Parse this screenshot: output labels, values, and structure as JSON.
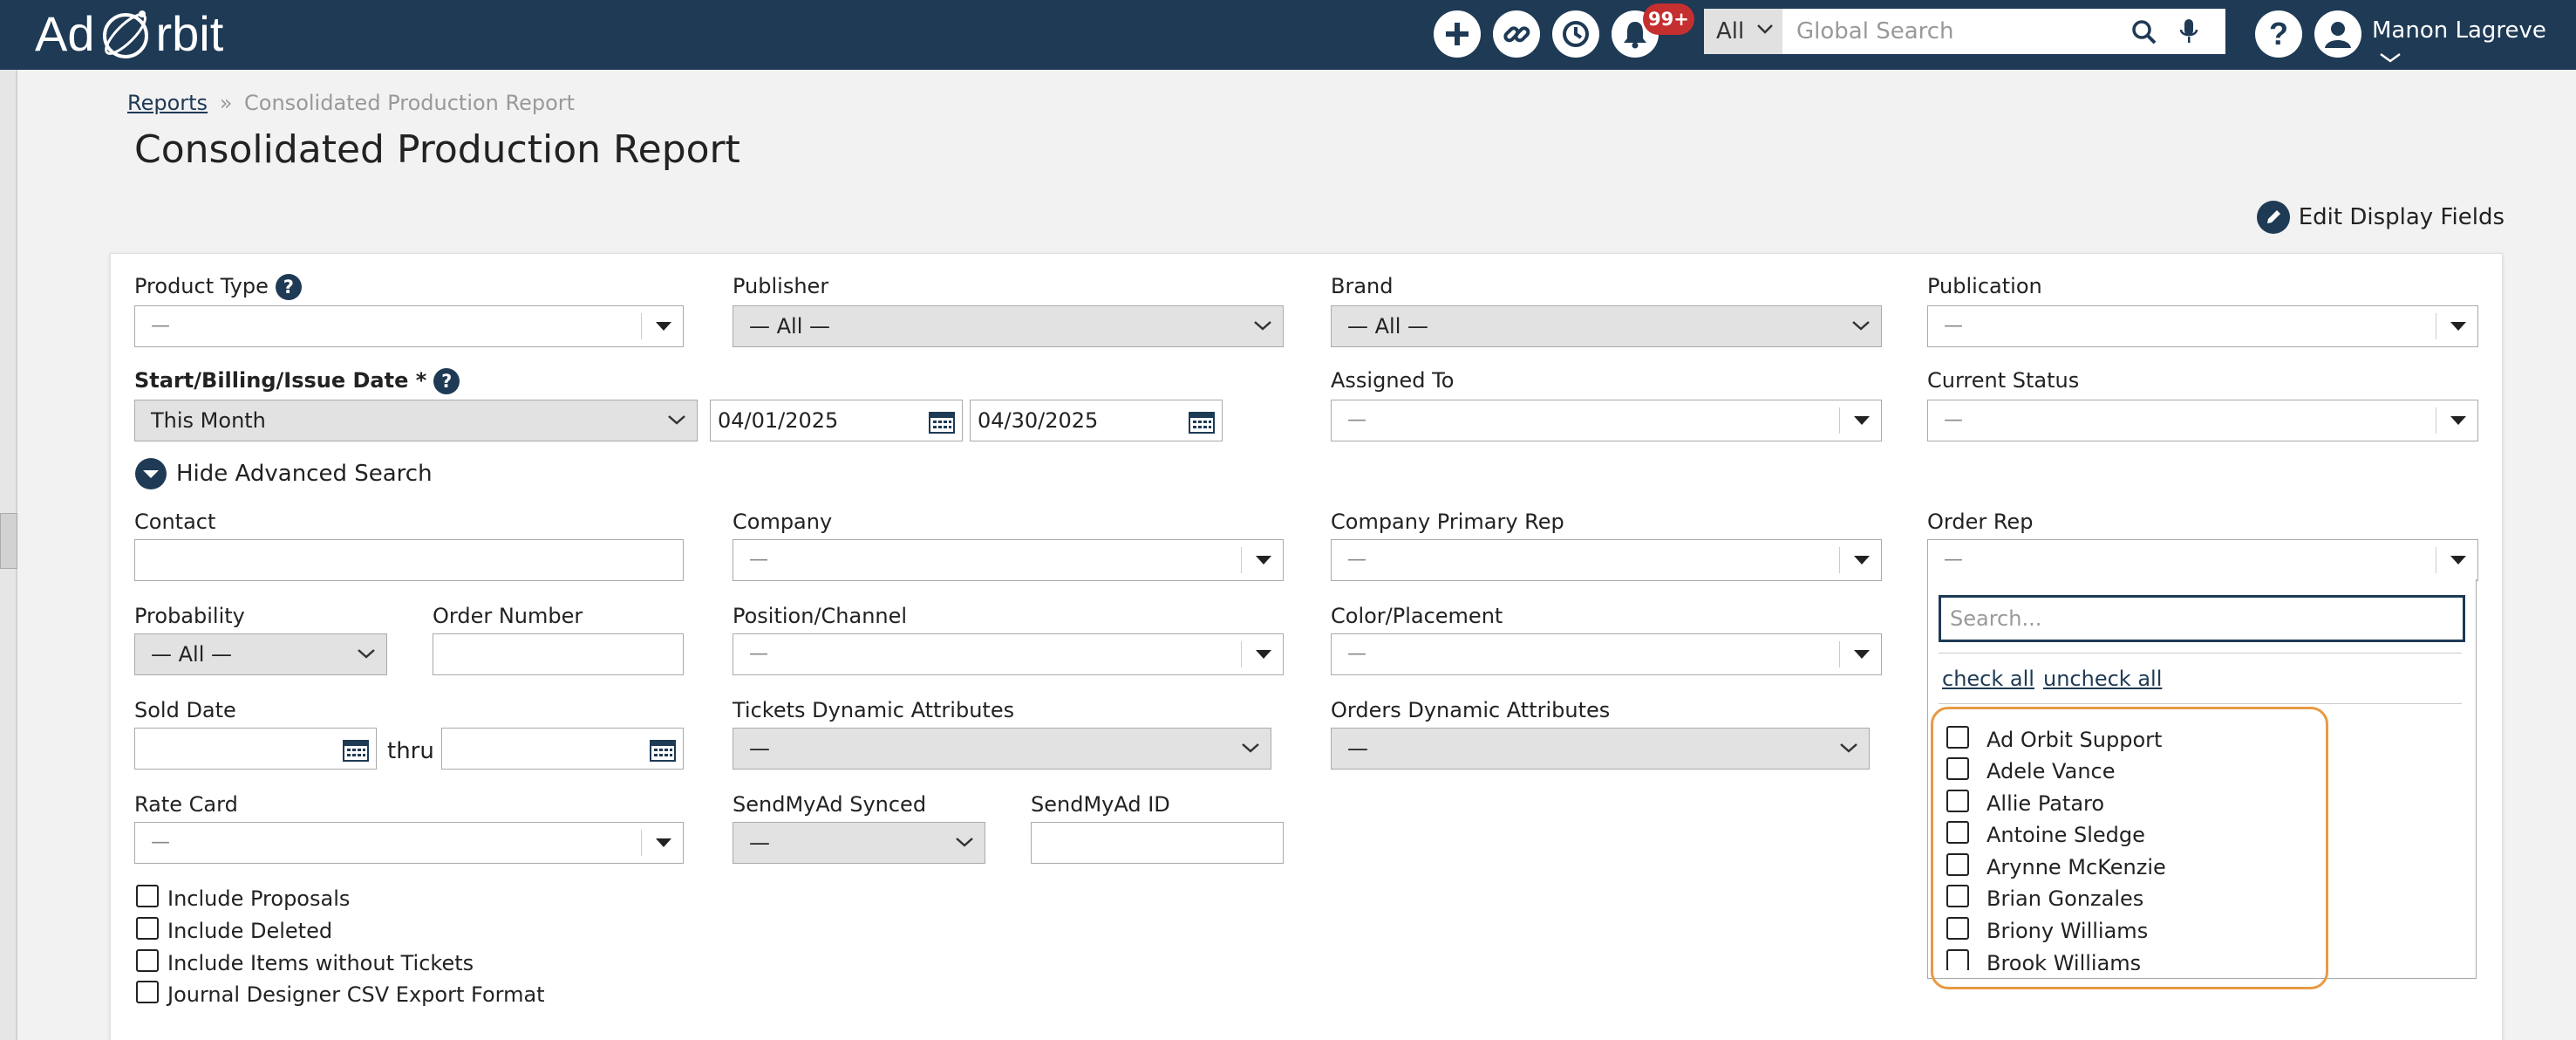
{
  "app": {
    "logo_left": "Ad",
    "logo_right": "rbit"
  },
  "header": {
    "notifications_badge": "99+",
    "search_scope": "All",
    "search_placeholder": "Global Search",
    "user_name": "Manon Lagreve"
  },
  "breadcrumb": {
    "root": "Reports",
    "separator": "»",
    "current": "Consolidated Production Report"
  },
  "page": {
    "title": "Consolidated Production Report",
    "edit_display_fields": "Edit Display Fields"
  },
  "filters": {
    "product_type": {
      "label": "Product Type",
      "value": "—"
    },
    "publisher": {
      "label": "Publisher",
      "value": "— All —"
    },
    "brand": {
      "label": "Brand",
      "value": "— All —"
    },
    "publication": {
      "label": "Publication",
      "value": "—"
    },
    "date": {
      "label": "Start/Billing/Issue Date *",
      "range": "This Month",
      "from": "04/01/2025",
      "to": "04/30/2025"
    },
    "assigned_to": {
      "label": "Assigned To",
      "value": "—"
    },
    "current_status": {
      "label": "Current Status",
      "value": "—"
    },
    "advanced_toggle": "Hide Advanced Search",
    "contact": {
      "label": "Contact",
      "value": ""
    },
    "company": {
      "label": "Company",
      "value": "—"
    },
    "company_primary_rep": {
      "label": "Company Primary Rep",
      "value": "—"
    },
    "order_rep": {
      "label": "Order Rep",
      "value": "—"
    },
    "probability": {
      "label": "Probability",
      "value": "— All —"
    },
    "order_number": {
      "label": "Order Number",
      "value": ""
    },
    "position_channel": {
      "label": "Position/Channel",
      "value": "—"
    },
    "color_placement": {
      "label": "Color/Placement",
      "value": "—"
    },
    "sold_date": {
      "label": "Sold Date",
      "thru": "thru"
    },
    "tickets_dyn": {
      "label": "Tickets Dynamic Attributes",
      "value": "—"
    },
    "orders_dyn": {
      "label": "Orders Dynamic Attributes",
      "value": "—"
    },
    "rate_card": {
      "label": "Rate Card",
      "value": "—"
    },
    "sendmyad_synced": {
      "label": "SendMyAd Synced",
      "value": "—"
    },
    "sendmyad_id": {
      "label": "SendMyAd ID",
      "value": ""
    },
    "checkboxes": [
      "Include Proposals",
      "Include Deleted",
      "Include Items without Tickets",
      "Journal Designer CSV Export Format"
    ]
  },
  "order_rep_dropdown": {
    "search_placeholder": "Search...",
    "check_all": "check all",
    "uncheck_all": "uncheck all",
    "items": [
      "Ad Orbit Support",
      "Adele Vance",
      "Allie Pataro",
      "Antoine Sledge",
      "Arynne McKenzie",
      "Brian Gonzales",
      "Briony Williams",
      "Brook Williams"
    ]
  },
  "colors": {
    "navy": "#1e3a55",
    "badge_red": "#c62f2f",
    "highlight_orange": "#e89a44"
  }
}
